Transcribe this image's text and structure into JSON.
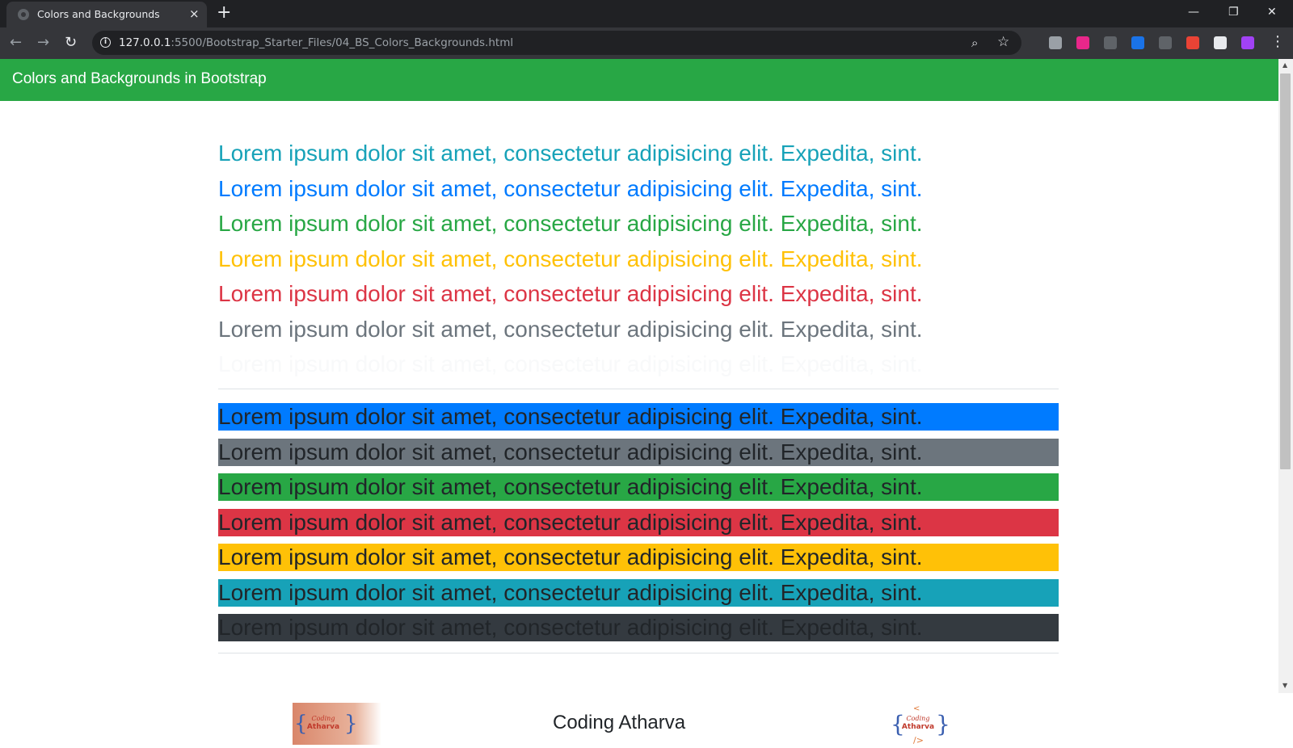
{
  "browser": {
    "tab_title": "Colors and Backgrounds",
    "tab_close": "×",
    "new_tab": "+",
    "window_controls": {
      "minimize": "—",
      "restore": "❐",
      "close": "✕"
    },
    "url_host": "127.0.0.1",
    "url_path": ":5500/Bootstrap_Starter_Files/04_BS_Colors_Backgrounds.html",
    "extensions": [
      {
        "name": "extension-1",
        "color": "#9aa0a6"
      },
      {
        "name": "extension-2",
        "color": "#e8278a"
      },
      {
        "name": "extension-3",
        "color": "#5f6368"
      },
      {
        "name": "extension-4",
        "color": "#1a73e8"
      },
      {
        "name": "extension-5",
        "color": "#5f6368"
      },
      {
        "name": "extension-6",
        "color": "#ea4335"
      },
      {
        "name": "extension-7",
        "color": "#e8eaed"
      },
      {
        "name": "extension-8",
        "color": "#a142f4"
      }
    ]
  },
  "navbar": {
    "brand": "Colors and Backgrounds in Bootstrap",
    "color": "#28a745"
  },
  "text_colors": [
    {
      "text": "Lorem ipsum dolor sit amet, consectetur adipisicing elit. Expedita, sint.",
      "color": "#17a2b8"
    },
    {
      "text": "Lorem ipsum dolor sit amet, consectetur adipisicing elit. Expedita, sint.",
      "color": "#007bff"
    },
    {
      "text": "Lorem ipsum dolor sit amet, consectetur adipisicing elit. Expedita, sint.",
      "color": "#28a745"
    },
    {
      "text": "Lorem ipsum dolor sit amet, consectetur adipisicing elit. Expedita, sint.",
      "color": "#ffc107"
    },
    {
      "text": "Lorem ipsum dolor sit amet, consectetur adipisicing elit. Expedita, sint.",
      "color": "#dc3545"
    },
    {
      "text": "Lorem ipsum dolor sit amet, consectetur adipisicing elit. Expedita, sint.",
      "color": "#6c757d"
    },
    {
      "text": "Lorem ipsum dolor sit amet, consectetur adipisicing elit. Expedita, sint.",
      "color": "#f8f9fa"
    }
  ],
  "bg_colors": [
    {
      "text": "Lorem ipsum dolor sit amet, consectetur adipisicing elit. Expedita, sint.",
      "background": "#007bff"
    },
    {
      "text": "Lorem ipsum dolor sit amet, consectetur adipisicing elit. Expedita, sint.",
      "background": "#6c757d"
    },
    {
      "text": "Lorem ipsum dolor sit amet, consectetur adipisicing elit. Expedita, sint.",
      "background": "#28a745"
    },
    {
      "text": "Lorem ipsum dolor sit amet, consectetur adipisicing elit. Expedita, sint.",
      "background": "#dc3545"
    },
    {
      "text": "Lorem ipsum dolor sit amet, consectetur adipisicing elit. Expedita, sint.",
      "background": "#ffc107"
    },
    {
      "text": "Lorem ipsum dolor sit amet, consectetur adipisicing elit. Expedita, sint.",
      "background": "#17a2b8"
    },
    {
      "text": "Lorem ipsum dolor sit amet, consectetur adipisicing elit. Expedita, sint.",
      "background": "#343a40"
    }
  ],
  "footer": {
    "brand": "Coding Atharva",
    "logo_text_top": "Coding",
    "logo_text_bottom": "Atharva"
  }
}
